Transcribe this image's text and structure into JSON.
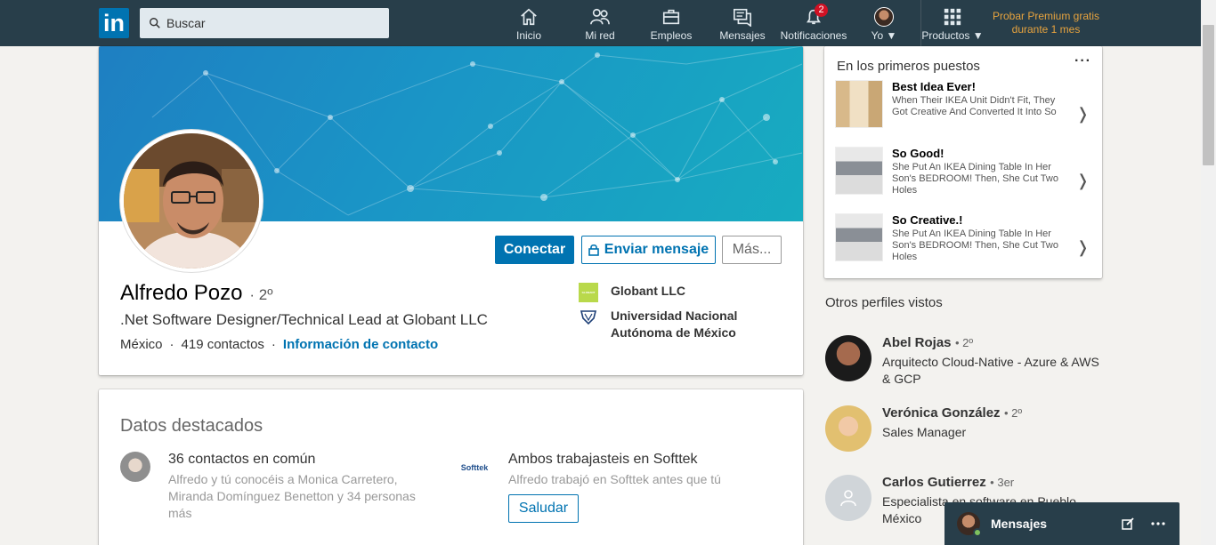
{
  "nav": {
    "search_placeholder": "Buscar",
    "items": [
      {
        "label": "Inicio",
        "icon": "home-icon"
      },
      {
        "label": "Mi red",
        "icon": "network-icon"
      },
      {
        "label": "Empleos",
        "icon": "briefcase-icon"
      },
      {
        "label": "Mensajes",
        "icon": "messages-icon"
      },
      {
        "label": "Notificaciones",
        "icon": "bell-icon",
        "badge": "2"
      },
      {
        "label": "Yo",
        "icon": "avatar"
      },
      {
        "label": "Productos",
        "icon": "grid-icon"
      }
    ],
    "premium": "Probar Premium gratis durante 1 mes",
    "logo": "in"
  },
  "profile": {
    "name": "Alfredo Pozo",
    "degree": "· 2º",
    "headline": ".Net Software Designer/Technical Lead at Globant LLC",
    "location": "México",
    "separator": "·",
    "connections": "419 contactos",
    "contact_info": "Información de contacto",
    "buttons": {
      "connect": "Conectar",
      "message": "Enviar mensaje",
      "more": "Más..."
    },
    "company": "Globant LLC",
    "school": "Universidad Nacional Autónoma de México",
    "company_logo_text": "GLOBANT"
  },
  "highlights": {
    "title": "Datos destacados",
    "mutual": {
      "head": "36 contactos en común",
      "sub": "Alfredo y tú conocéis a Monica Carretero, Miranda Domínguez Benetton y 34 personas más"
    },
    "shared_company": {
      "head": "Ambos trabajasteis en Softtek",
      "sub": "Alfredo trabajó en Softtek antes que tú",
      "button": "Saludar",
      "logo_text": "Softtek"
    }
  },
  "ads": {
    "title": "En los primeros puestos",
    "more": "···",
    "items": [
      {
        "head": "Best Idea Ever!",
        "sub": "When Their IKEA Unit Didn't Fit, They Got Creative And Converted It Into So"
      },
      {
        "head": "So Good!",
        "sub": "She Put An IKEA Dining Table In Her Son's BEDROOM! Then, She Cut Two Holes"
      },
      {
        "head": "So Creative.!",
        "sub": "She Put An IKEA Dining Table In Her Son's BEDROOM! Then, She Cut Two Holes"
      }
    ],
    "chevron": "❭"
  },
  "others": {
    "title": "Otros perfiles vistos",
    "people": [
      {
        "name": "Abel Rojas",
        "degree": "• 2º",
        "job": "Arquitecto Cloud-Native - Azure & AWS & GCP"
      },
      {
        "name": "Verónica González",
        "degree": "• 2º",
        "job": "Sales Manager"
      },
      {
        "name": "Carlos Gutierrez",
        "degree": "• 3er",
        "job": "Especialista en software en Pueblo México"
      }
    ]
  },
  "messaging": {
    "title": "Mensajes"
  },
  "colors": {
    "brand": "#0073b1",
    "nav_bg": "#283e4a",
    "premium": "#e7a33e",
    "badge": "#d11124"
  }
}
